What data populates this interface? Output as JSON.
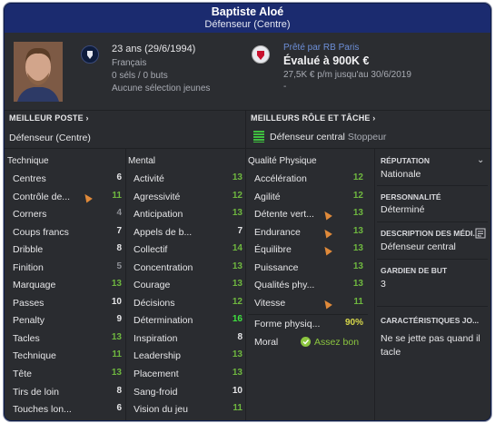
{
  "title": {
    "name": "Baptiste Aloé",
    "position": "Défenseur (Centre)"
  },
  "profile": {
    "age": "23 ans (29/6/1994)",
    "nationality": "Français",
    "caps": "0 séls / 0 buts",
    "youth": "Aucune sélection jeunes",
    "loan": "Prêté par RB Paris",
    "value": "Évalué à 900K €",
    "wage": "27,5K € p/m jusqu'au 30/6/2019",
    "extra": "-"
  },
  "best_position": {
    "header": "MEILLEUR POSTE",
    "value": "Défenseur (Centre)"
  },
  "best_role": {
    "header": "MEILLEURS RÔLE ET TÂCHE",
    "role": "Défenseur central",
    "duty": "Stoppeur"
  },
  "technique": {
    "header": "Technique",
    "items": [
      {
        "label": "Centres",
        "value": "6"
      },
      {
        "label": "Contrôle de...",
        "value": "11"
      },
      {
        "label": "Corners",
        "value": "4"
      },
      {
        "label": "Coups francs",
        "value": "7"
      },
      {
        "label": "Dribble",
        "value": "8"
      },
      {
        "label": "Finition",
        "value": "5"
      },
      {
        "label": "Marquage",
        "value": "13"
      },
      {
        "label": "Passes",
        "value": "10"
      },
      {
        "label": "Penalty",
        "value": "9"
      },
      {
        "label": "Tacles",
        "value": "13"
      },
      {
        "label": "Technique",
        "value": "11"
      },
      {
        "label": "Tête",
        "value": "13"
      },
      {
        "label": "Tirs de loin",
        "value": "8"
      },
      {
        "label": "Touches lon...",
        "value": "6"
      }
    ]
  },
  "mental": {
    "header": "Mental",
    "items": [
      {
        "label": "Activité",
        "value": "13"
      },
      {
        "label": "Agressivité",
        "value": "12"
      },
      {
        "label": "Anticipation",
        "value": "13"
      },
      {
        "label": "Appels de b...",
        "value": "7"
      },
      {
        "label": "Collectif",
        "value": "14"
      },
      {
        "label": "Concentration",
        "value": "13"
      },
      {
        "label": "Courage",
        "value": "13"
      },
      {
        "label": "Décisions",
        "value": "12"
      },
      {
        "label": "Détermination",
        "value": "16"
      },
      {
        "label": "Inspiration",
        "value": "8"
      },
      {
        "label": "Leadership",
        "value": "13"
      },
      {
        "label": "Placement",
        "value": "13"
      },
      {
        "label": "Sang-froid",
        "value": "10"
      },
      {
        "label": "Vision du jeu",
        "value": "11"
      }
    ]
  },
  "physical": {
    "header": "Qualité Physique",
    "items": [
      {
        "label": "Accélération",
        "value": "12"
      },
      {
        "label": "Agilité",
        "value": "12"
      },
      {
        "label": "Détente vert...",
        "value": "13"
      },
      {
        "label": "Endurance",
        "value": "13"
      },
      {
        "label": "Équilibre",
        "value": "13"
      },
      {
        "label": "Puissance",
        "value": "13"
      },
      {
        "label": "Qualités phy...",
        "value": "13"
      },
      {
        "label": "Vitesse",
        "value": "11"
      }
    ],
    "fitness_label": "Forme physiq...",
    "fitness_value": "90%",
    "morale_label": "Moral",
    "morale_value": "Assez bon"
  },
  "side": {
    "reputation_h": "RÉPUTATION",
    "reputation": "Nationale",
    "personality_h": "PERSONNALITÉ",
    "personality": "Déterminé",
    "media_h": "DESCRIPTION DES MÉDI...",
    "media": "Défenseur central",
    "gk_h": "GARDIEN DE BUT",
    "gk": "3",
    "traits_h": "CARACTÉRISTIQUES JO...",
    "traits": "Ne se jette pas quand il tacle"
  }
}
